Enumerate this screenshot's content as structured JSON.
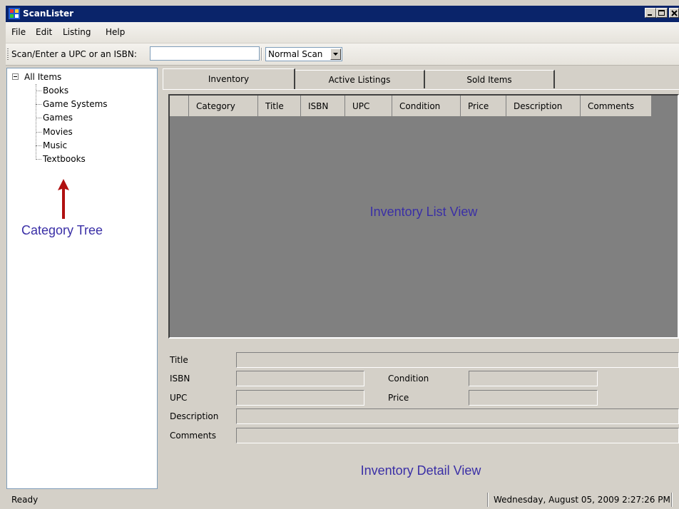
{
  "window": {
    "title": "ScanLister"
  },
  "menu": [
    "File",
    "Edit",
    "Listing",
    "Help"
  ],
  "toolbar": {
    "scan_label": "Scan/Enter a UPC or an ISBN:",
    "scan_value": "",
    "mode_value": "Normal Scan"
  },
  "tree": {
    "root": "All Items",
    "items": [
      "Books",
      "Game Systems",
      "Games",
      "Movies",
      "Music",
      "Textbooks"
    ],
    "annotation": "Category Tree"
  },
  "tabs": [
    "Inventory",
    "Active Listings",
    "Sold Items"
  ],
  "list": {
    "columns": [
      "Category",
      "Title",
      "ISBN",
      "UPC",
      "Condition",
      "Price",
      "Description",
      "Comments"
    ],
    "annotation": "Inventory List View"
  },
  "detail": {
    "labels": {
      "title": "Title",
      "isbn": "ISBN",
      "upc": "UPC",
      "condition": "Condition",
      "price": "Price",
      "description": "Description",
      "comments": "Comments"
    },
    "annotation": "Inventory Detail View"
  },
  "status": {
    "ready": "Ready",
    "datetime": "Wednesday, August 05, 2009 2:27:26 PM"
  },
  "colors": {
    "titlebar": "#0a246a",
    "annotation": "#3a2fa6",
    "arrow": "#b01010",
    "listbg": "#808080"
  }
}
